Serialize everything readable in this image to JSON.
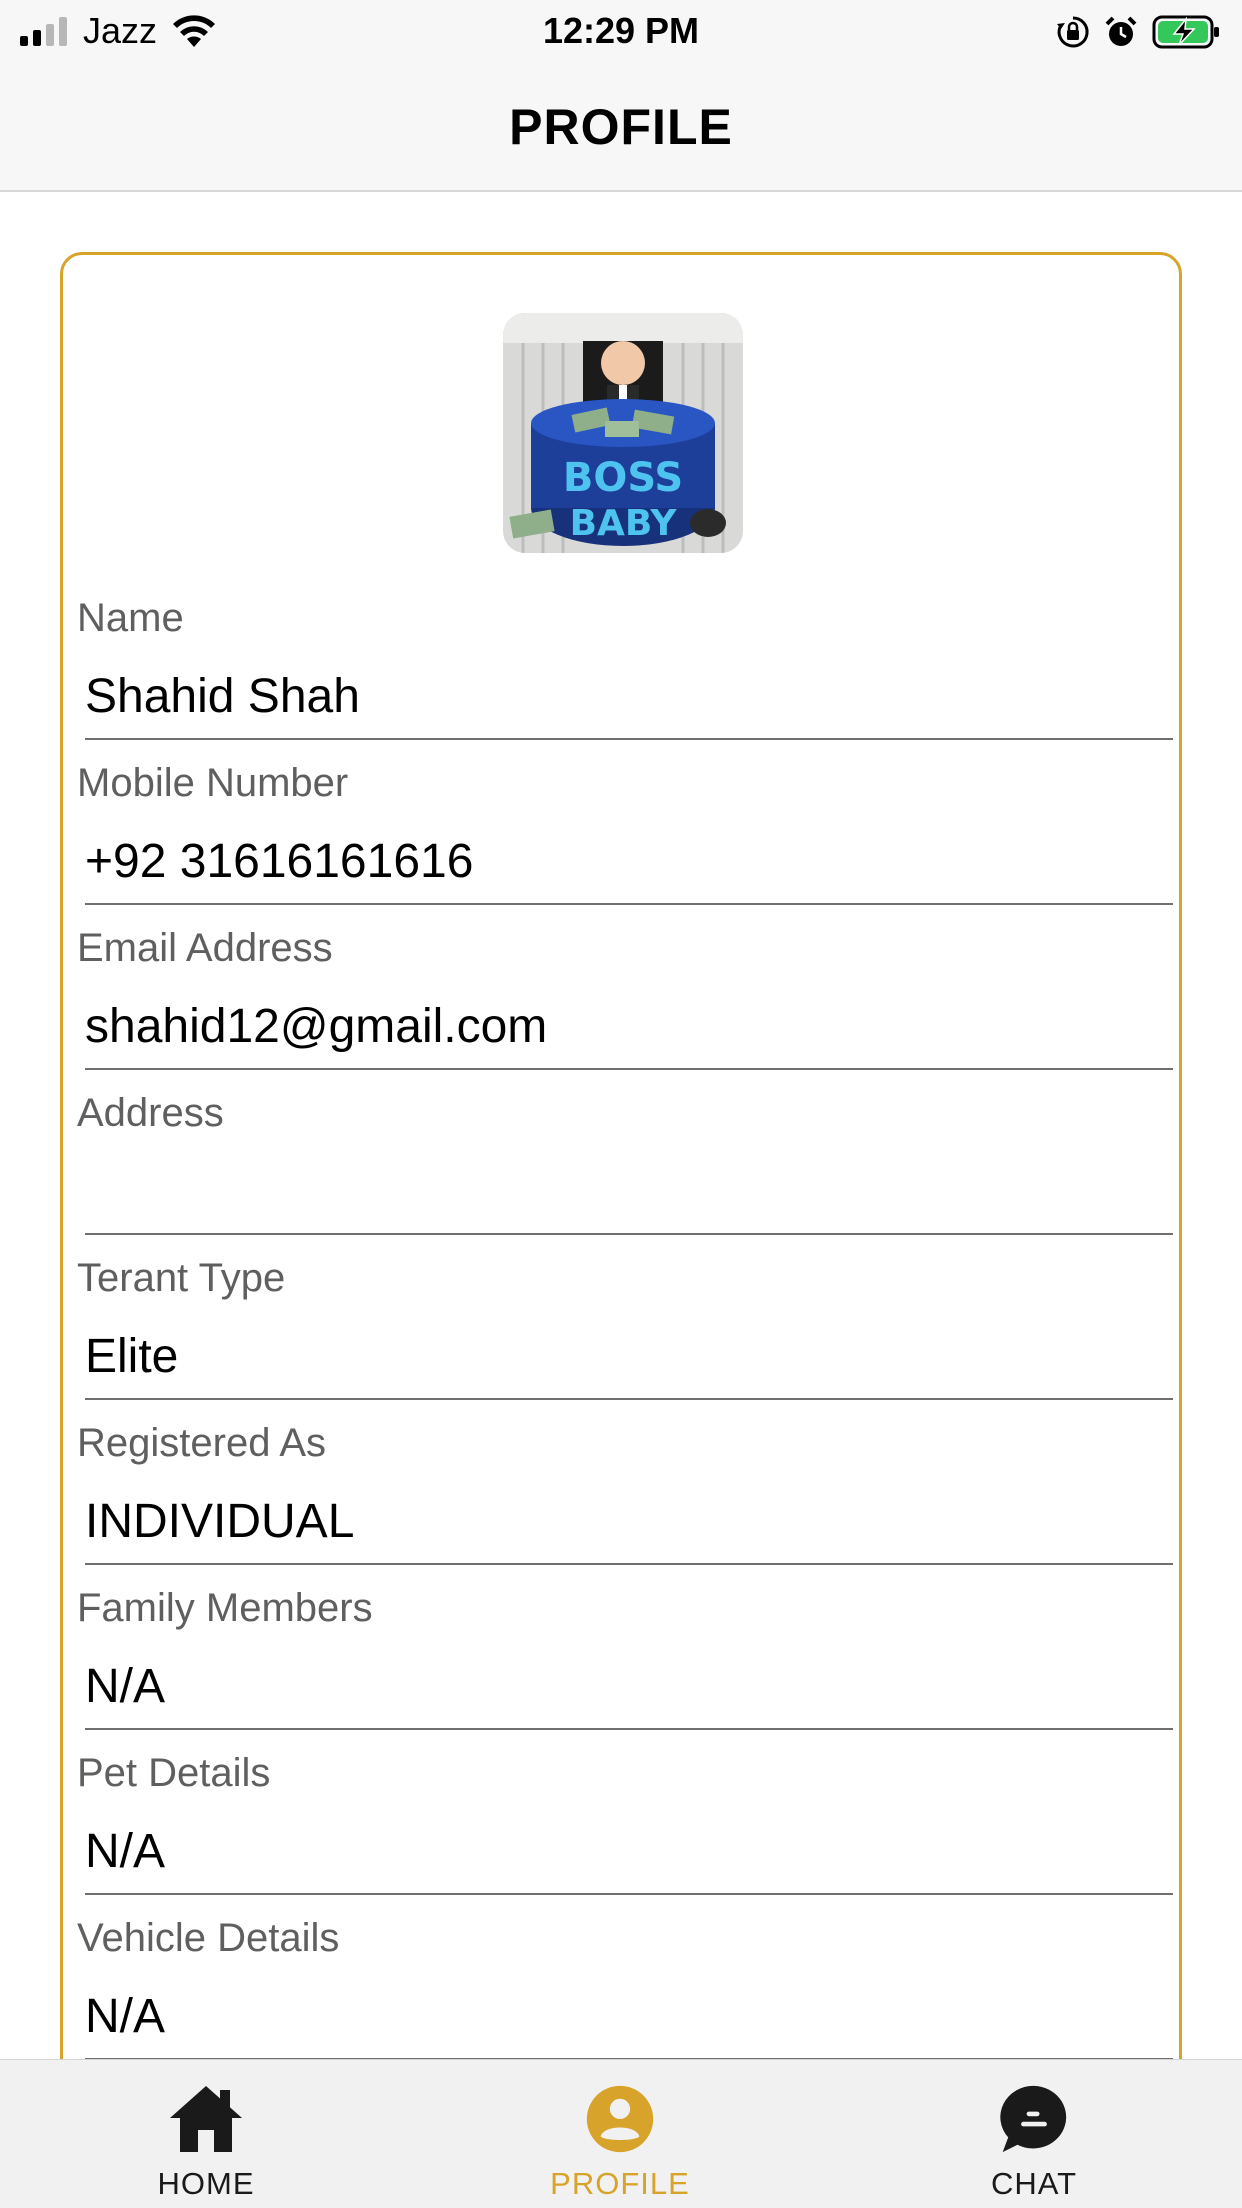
{
  "status_bar": {
    "carrier": "Jazz",
    "time": "12:29 PM",
    "battery_color": "#34c759"
  },
  "header": {
    "title": "PROFILE"
  },
  "profile": {
    "avatar_icon": "profile-photo",
    "fields": [
      {
        "label": "Name",
        "value": "Shahid Shah"
      },
      {
        "label": "Mobile Number",
        "value": "+92 31616161616"
      },
      {
        "label": "Email Address",
        "value": "shahid12@gmail.com"
      },
      {
        "label": "Address",
        "value": ""
      },
      {
        "label": "Terant Type",
        "value": "Elite"
      },
      {
        "label": "Registered As",
        "value": "INDIVIDUAL"
      },
      {
        "label": "Family Members",
        "value": "N/A"
      },
      {
        "label": "Pet Details",
        "value": "N/A"
      },
      {
        "label": "Vehicle Details",
        "value": "N/A"
      }
    ]
  },
  "tab_bar": {
    "accent_color": "#d8a32b",
    "tabs": [
      {
        "label": "HOME",
        "icon": "home-icon",
        "active": false
      },
      {
        "label": "PROFILE",
        "icon": "person-icon",
        "active": true
      },
      {
        "label": "CHAT",
        "icon": "chat-icon",
        "active": false
      }
    ]
  }
}
